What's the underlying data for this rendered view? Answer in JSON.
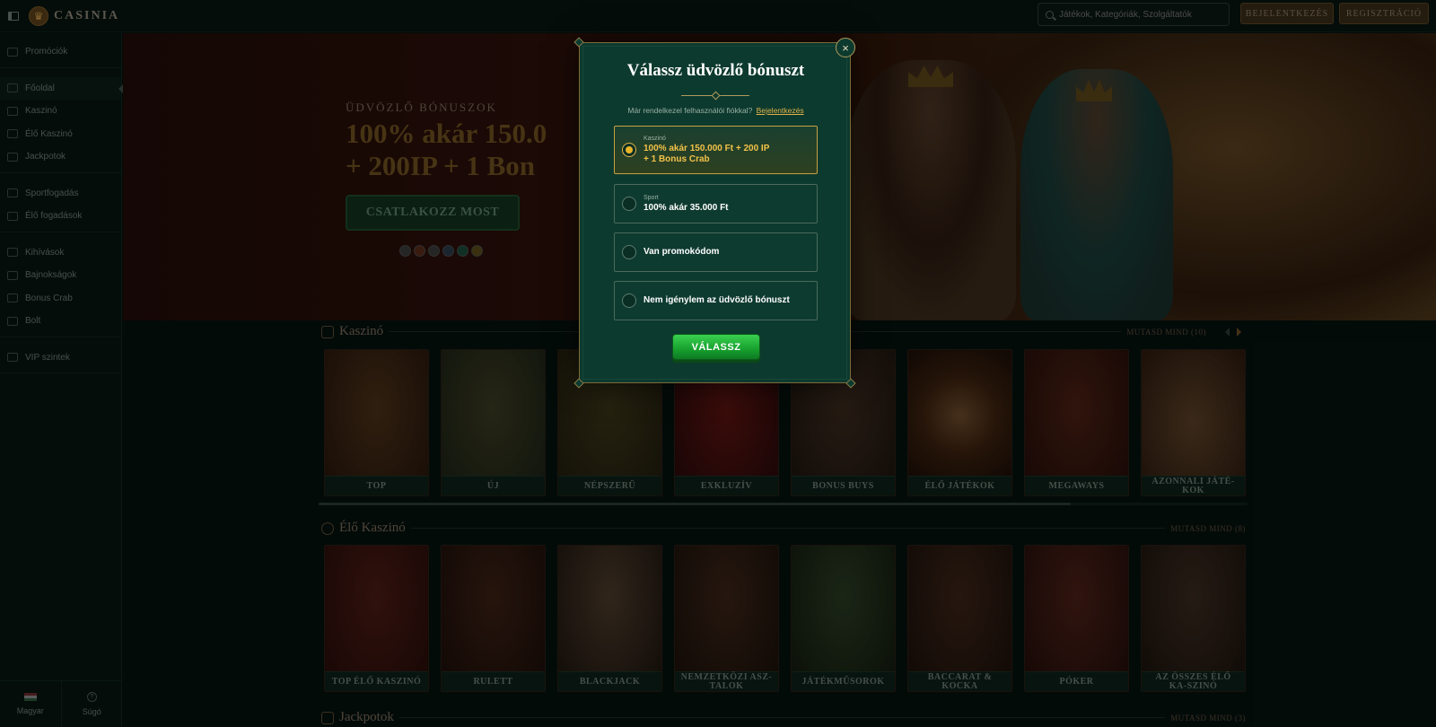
{
  "header": {
    "logo_text": "CASINIA",
    "search_placeholder": "Játékok, Kategóriák, Szolgáltatók",
    "login_label": "BEJELENTKEZÉS",
    "register_label": "REGISZTRÁCIÓ"
  },
  "sidebar": {
    "groups": [
      [
        "Promóciók"
      ],
      [
        "Főoldal",
        "Kaszinó",
        "Élő Kaszinó",
        "Jackpotok"
      ],
      [
        "Sportfogadás",
        "Élő fogadások"
      ],
      [
        "Kihívások",
        "Bajnokságok",
        "Bonus Crab",
        "Bolt"
      ],
      [
        "VIP szintek"
      ]
    ],
    "items": {
      "promotions": "Promóciók",
      "home": "Főoldal",
      "casino": "Kaszinó",
      "live_casino": "Élő Kaszinó",
      "jackpots": "Jackpotok",
      "sports": "Sportfogadás",
      "live_bets": "Élő fogadások",
      "challenges": "Kihívások",
      "tournaments": "Bajnokságok",
      "bonus_crab": "Bonus Crab",
      "shop": "Bolt",
      "vip": "VIP szintek"
    },
    "active": "Főoldal",
    "language_label": "Magyar",
    "help_label": "Súgó"
  },
  "hero": {
    "kicker": "ÜDVÖZLŐ BÓNUSZOK",
    "title_line1": "100% akár 150.0",
    "title_line2": "+ 200IP + 1 Bon",
    "cta_label": "CSATLAKOZZ MOST"
  },
  "sections": {
    "casino": {
      "title": "Kaszinó",
      "more": "MUTASD MIND (10)",
      "cards": [
        "TOP",
        "ÚJ",
        "NÉPSZERŰ",
        "EXKLUZÍV",
        "BONUS BUYS",
        "ÉLŐ JÁTÉKOK",
        "MEGAWAYS",
        "AZONNALI JÁTÉ-KOK"
      ]
    },
    "live": {
      "title": "Élő Kaszinó",
      "more": "MUTASD MIND (8)",
      "cards": [
        "TOP ÉLŐ KASZINÓ",
        "RULETT",
        "BLACKJACK",
        "NEMZETKÖZI ASZ-TALOK",
        "JÁTÉKMŰSOROK",
        "BACCARAT & KOCKA",
        "PÓKER",
        "AZ ÖSSZES ÉLŐ KA-SZINÓ"
      ]
    },
    "jackpots": {
      "title": "Jackpotok",
      "more": "MUTASD MIND (3)"
    }
  },
  "modal": {
    "title": "Válassz üdvözlő bónuszt",
    "login_prompt": "Már rendelkezel felhasználói fiókkal?",
    "login_link": "Bejelentkezés",
    "options": {
      "casino": {
        "category": "Kaszinó",
        "text_line1": "100% akár 150.000 Ft + 200 IP",
        "text_line2": "+ 1 Bonus Crab",
        "selected": true
      },
      "sport": {
        "category": "Sport",
        "text": "100% akár 35.000 Ft",
        "selected": false
      },
      "promo": {
        "text": "Van promokódom",
        "selected": false
      },
      "none": {
        "text": "Nem igénylem az üdvözlő bónuszt",
        "selected": false
      }
    },
    "choose_label": "VÁLASSZ",
    "close_symbol": "×"
  },
  "colors": {
    "background": "#06120f",
    "modal_bg": "#0d3a2e",
    "gold_accent": "#e0b24a",
    "green_button": "#17a02e"
  }
}
